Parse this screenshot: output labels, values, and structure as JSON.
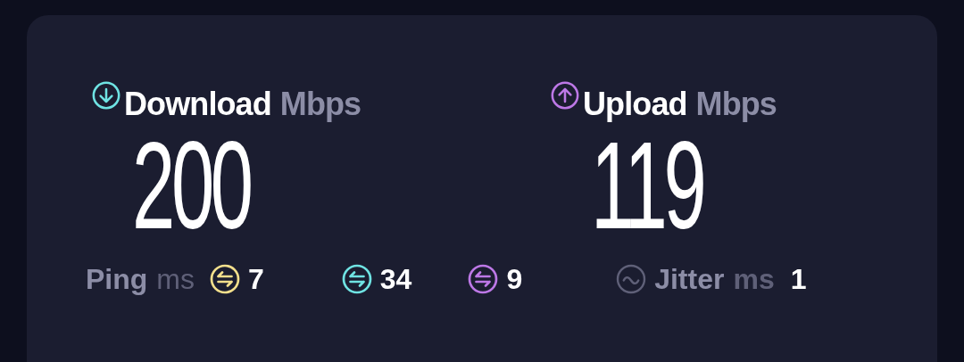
{
  "metrics": [
    {
      "kind": "download",
      "label": "Download",
      "unit": "Mbps",
      "value": "200"
    },
    {
      "kind": "upload",
      "label": "Upload",
      "unit": "Mbps",
      "value": "119"
    }
  ],
  "ping": {
    "label": "Ping",
    "unit": "ms",
    "items": [
      {
        "value": "7",
        "color": "#f3df8c"
      },
      {
        "value": "34",
        "color": "#6fe3e3"
      },
      {
        "value": "9",
        "color": "#bd78e6"
      }
    ]
  },
  "jitter": {
    "label": "Jitter",
    "unit": "ms",
    "value": "1"
  }
}
